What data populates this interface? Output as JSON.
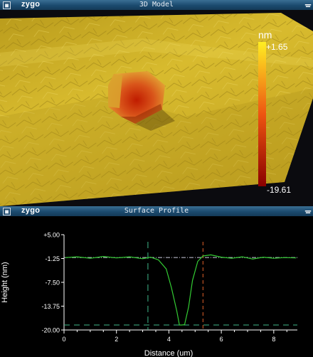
{
  "model_window": {
    "logo": "zygo",
    "title": "3D Model",
    "colorbar": {
      "unit": "nm",
      "max_label": "+1.65",
      "min_label": "-19.61",
      "color_top": "#ffee22",
      "color_mid": "#ee5511",
      "color_bottom": "#8a0000"
    }
  },
  "profile_window": {
    "logo": "zygo",
    "title": "Surface Profile"
  },
  "colors": {
    "titlebar": "#1b4a6e",
    "surface": "#c9ad28",
    "profile_line": "#33cc33"
  },
  "chart_data": {
    "type": "line",
    "xlabel": "Distance (um)",
    "ylabel": "Height (nm)",
    "xlim": [
      0,
      8.9
    ],
    "ylim": [
      -20,
      5
    ],
    "x_ticks": [
      0,
      2,
      4,
      6,
      8
    ],
    "y_ticks": [
      "+5.00",
      "-1.25",
      "-7.50",
      "-13.75",
      "-20.00"
    ],
    "y_tick_values": [
      5,
      -1.25,
      -7.5,
      -13.75,
      -20
    ],
    "reference_lines": {
      "top_level": -1.0,
      "bottom_level": -18.7,
      "left_cursor_x": 3.2,
      "right_cursor_x": 5.3
    },
    "series": [
      {
        "x": [
          0.05,
          0.5,
          1.0,
          1.5,
          2.0,
          2.5,
          3.0,
          3.3,
          3.6,
          3.9,
          4.1,
          4.3,
          4.4,
          4.5,
          4.6,
          4.75,
          4.9,
          5.1,
          5.3,
          5.6,
          6.0,
          6.4,
          6.8,
          7.2,
          7.6,
          8.0,
          8.4,
          8.85
        ],
        "y": [
          -1.0,
          -0.8,
          -1.2,
          -0.7,
          -1.1,
          -0.8,
          -1.3,
          -0.9,
          -1.6,
          -4.0,
          -9.0,
          -15.0,
          -18.7,
          -18.7,
          -18.6,
          -14.0,
          -7.0,
          -2.0,
          -0.6,
          -0.3,
          -0.9,
          -1.2,
          -0.8,
          -1.4,
          -0.9,
          -1.2,
          -1.0,
          -1.1
        ]
      }
    ]
  }
}
